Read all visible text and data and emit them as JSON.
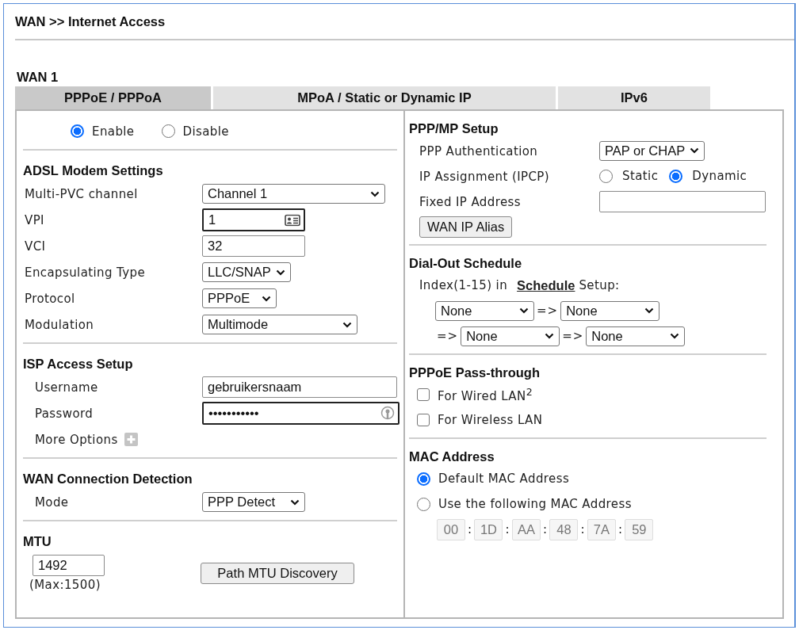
{
  "title": "WAN >> Internet Access",
  "wan_label": "WAN 1",
  "tabs": [
    {
      "label": "PPPoE / PPPoA",
      "selected": true
    },
    {
      "label": "MPoA / Static or Dynamic IP",
      "selected": false
    },
    {
      "label": "IPv6",
      "selected": false
    }
  ],
  "columns": [
    {
      "sections": [
        {
          "rows": [
            {
              "kind": "radios",
              "options": [
                {
                  "label": "Enable",
                  "selected": true
                },
                {
                  "label": "Disable",
                  "selected": false
                }
              ]
            }
          ]
        },
        {
          "heading": "ADSL Modem Settings",
          "rows": [
            {
              "kind": "select",
              "label": "Multi-PVC channel",
              "value": "Channel 1"
            },
            {
              "kind": "autofill",
              "label": "VPI",
              "value": "1"
            },
            {
              "kind": "field",
              "label": "VCI",
              "value": "32"
            },
            {
              "kind": "select",
              "label": "Encapsulating Type",
              "value": "LLC/SNAP"
            },
            {
              "kind": "select",
              "label": "Protocol",
              "value": "PPPoE"
            },
            {
              "kind": "select",
              "label": "Modulation",
              "value": "Multimode"
            }
          ]
        },
        {
          "heading": "ISP Access Setup",
          "rows": [
            {
              "kind": "field",
              "label": "Username",
              "value": "gebruikersnaam"
            },
            {
              "kind": "autofill",
              "label": "Password",
              "value": "•••••••••••"
            },
            {
              "kind": "expander",
              "label": "More Options"
            }
          ]
        },
        {
          "heading": "WAN Connection Detection",
          "rows": [
            {
              "kind": "select",
              "label": "Mode",
              "value": "PPP Detect"
            }
          ]
        },
        {
          "heading": "MTU",
          "rows": [
            {
              "kind": "mtu",
              "value": "1492",
              "note": "(Max:1500)",
              "button": "Path MTU Discovery"
            }
          ]
        }
      ]
    },
    {
      "sections": [
        {
          "heading": "PPP/MP Setup",
          "rows": [
            {
              "kind": "select",
              "label": "PPP Authentication",
              "value": "PAP or CHAP"
            },
            {
              "kind": "radios",
              "label": "IP Assignment (IPCP)",
              "options": [
                {
                  "label": "Static",
                  "selected": false
                },
                {
                  "label": "Dynamic",
                  "selected": true
                }
              ]
            },
            {
              "kind": "field",
              "label": "Fixed IP Address"
            },
            {
              "kind": "button",
              "label": "WAN IP Alias"
            }
          ]
        },
        {
          "heading": "Dial-Out Schedule",
          "rows": [
            {
              "kind": "link-text",
              "before": "Index(1-15) in",
              "link": "Schedule",
              "after": "Setup:"
            },
            {
              "kind": "schedule",
              "items": [
                {
                  "kind": "select",
                  "value": "None"
                },
                {
                  "kind": "arrow",
                  "text": "=>"
                },
                {
                  "kind": "select",
                  "value": "None"
                }
              ]
            },
            {
              "kind": "schedule",
              "items": [
                {
                  "kind": "arrow",
                  "text": "=>"
                },
                {
                  "kind": "select",
                  "value": "None"
                },
                {
                  "kind": "arrow",
                  "text": "=>"
                },
                {
                  "kind": "select",
                  "value": "None"
                }
              ]
            }
          ]
        },
        {
          "heading": "PPPoE Pass-through",
          "rows": [
            {
              "kind": "checkbox",
              "label": "For Wired LAN$^{2}$",
              "checked": false
            },
            {
              "kind": "checkbox",
              "label": "For Wireless LAN",
              "checked": false
            }
          ]
        },
        {
          "heading": "MAC Address",
          "rows": [
            {
              "kind": "option",
              "label": "Default MAC Address",
              "selected": true
            },
            {
              "kind": "option",
              "label": "Use the following MAC Address",
              "selected": false
            },
            {
              "kind": "mac",
              "separator": ":",
              "octets": [
                "00",
                "1D",
                "AA",
                "48",
                "7A",
                "59"
              ]
            }
          ]
        }
      ]
    }
  ]
}
